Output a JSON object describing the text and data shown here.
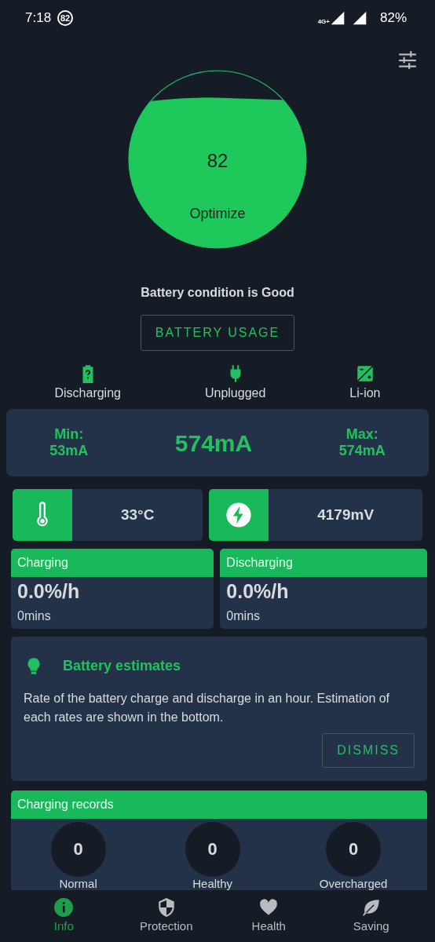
{
  "status_bar": {
    "time": "7:18",
    "notification": "82",
    "network": "4G+",
    "battery": "82%"
  },
  "gauge": {
    "value": "82",
    "label": "Optimize",
    "level": 0.82
  },
  "condition": "Battery condition is Good",
  "usage_button": "BATTERY USAGE",
  "info_items": [
    {
      "kind": "battery",
      "label": "Discharging"
    },
    {
      "kind": "plug",
      "label": "Unplugged"
    },
    {
      "kind": "cell",
      "label": "Li-ion"
    }
  ],
  "current": {
    "min_label": "Min:",
    "min": "53mA",
    "value": "574mA",
    "max_label": "Max:",
    "max": "574mA"
  },
  "sensors": [
    {
      "kind": "temperature",
      "value": "33°C"
    },
    {
      "kind": "voltage",
      "value": "4179mV"
    }
  ],
  "rates": [
    {
      "title": "Charging",
      "rate": "0.0%/h",
      "time": "0mins"
    },
    {
      "title": "Discharging",
      "rate": "0.0%/h",
      "time": "0mins"
    }
  ],
  "tip": {
    "title": "Battery estimates",
    "text": "Rate of the battery charge and discharge in an hour. Estimation of each rates are shown in the bottom.",
    "button": "DISMISS"
  },
  "records": {
    "title": "Charging records",
    "items": [
      {
        "count": "0",
        "label": "Normal"
      },
      {
        "count": "0",
        "label": "Healthy"
      },
      {
        "count": "0",
        "label": "Overcharged"
      }
    ]
  },
  "nav": [
    {
      "kind": "info",
      "label": "Info",
      "selected": true
    },
    {
      "kind": "shield",
      "label": "Protection",
      "selected": false
    },
    {
      "kind": "heart",
      "label": "Health",
      "selected": false
    },
    {
      "kind": "leaf",
      "label": "Saving",
      "selected": false
    }
  ]
}
